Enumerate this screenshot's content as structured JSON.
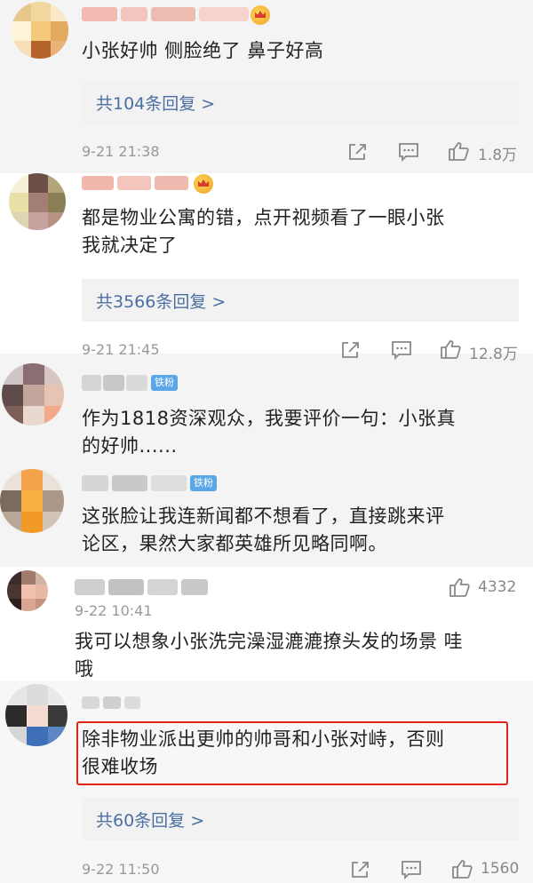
{
  "comments": [
    {
      "text_lines": [
        "小张好帅 侧脸绝了 鼻子好高"
      ],
      "reply_label": "共104条回复 >",
      "time": "9-21 21:38",
      "likes": "1.8万",
      "badge": "crown"
    },
    {
      "text_lines": [
        "都是物业公寓的错，点开视频看了一眼小张",
        "我就决定了"
      ],
      "reply_label": "共3566条回复 >",
      "time": "9-21 21:45",
      "likes": "12.8万",
      "badge": "crown"
    },
    {
      "text_lines": [
        "作为1818资深观众，我要评价一句：小张真",
        "的好帅......"
      ],
      "badge": "铁粉"
    },
    {
      "text_lines": [
        "这张脸让我连新闻都不想看了，直接跳来评",
        "论区，果然大家都英雄所见略同啊。"
      ],
      "badge": "铁粉"
    },
    {
      "text_lines": [
        "我可以想象小张洗完澡湿漉漉撩头发的场景 哇",
        "哦"
      ],
      "time": "9-22 10:41",
      "likes": "4332"
    },
    {
      "text_lines": [
        "除非物业派出更帅的帅哥和小张对峙，否则",
        "很难收场"
      ],
      "reply_label": "共60条回复 >",
      "time": "9-22 11:50",
      "likes": "1560"
    }
  ],
  "colors": {
    "link_blue": "#4b6fa3",
    "reply_bg": "#f2f2f2",
    "highlight_red": "#e0231a",
    "gray_band": "#f4f4f4",
    "fan_badge_blue": "#5aa6e6"
  },
  "icons": [
    "share-icon",
    "comment-icon",
    "like-icon"
  ]
}
